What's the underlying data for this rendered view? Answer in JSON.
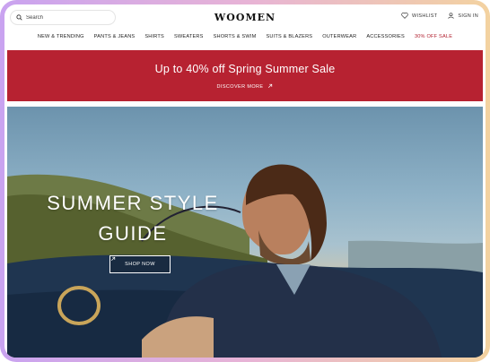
{
  "header": {
    "search_placeholder": "Search",
    "logo": "WOOMEN",
    "wishlist": "WISHLIST",
    "signin": "SIGN IN"
  },
  "nav": {
    "items": [
      "NEW & TRENDING",
      "PANTS & JEANS",
      "SHIRTS",
      "SWEATERS",
      "SHORTS & SWIM",
      "SUITS & BLAZERS",
      "OUTERWEAR",
      "ACCESSORIES",
      "30% OFF SALE"
    ]
  },
  "promo": {
    "title": "Up to 40% off Spring Summer Sale",
    "link": "DISCOVER MORE",
    "color": "#b72231"
  },
  "hero": {
    "title_line1": "SUMMER STYLE",
    "title_line2": "GUIDE",
    "button": "SHOP NOW"
  },
  "icons": [
    "search-icon",
    "heart-icon",
    "user-icon",
    "arrow-up-right-icon"
  ]
}
